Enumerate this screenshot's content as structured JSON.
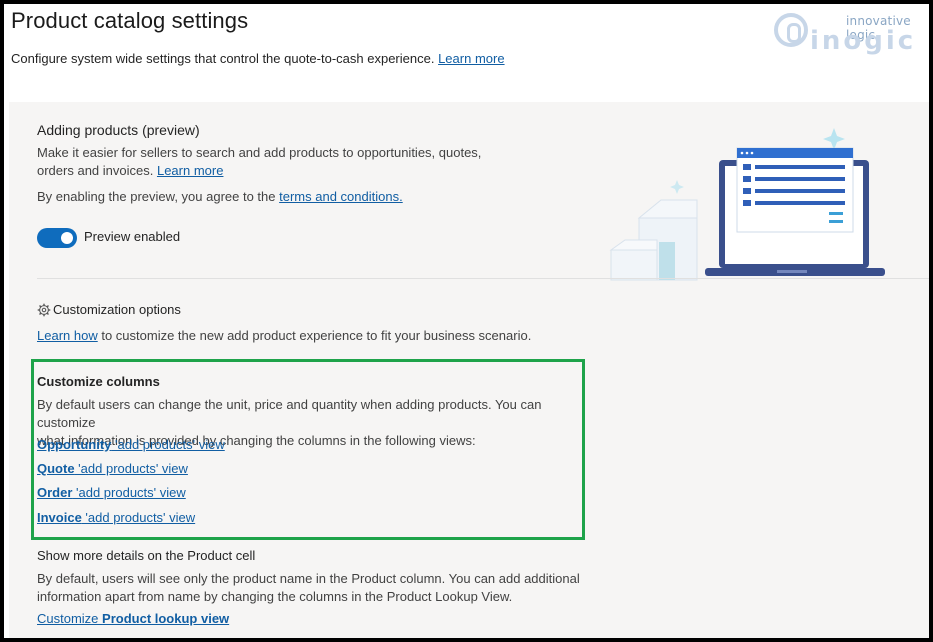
{
  "header": {
    "title": "Product catalog settings",
    "description": "Configure system wide settings that control the quote-to-cash experience.",
    "learn_more": "Learn more"
  },
  "logo": {
    "tagline": "innovative logic",
    "wordmark": "inogic"
  },
  "adding_products": {
    "title": "Adding products (preview)",
    "desc_line1": "Make it easier for sellers to search and add products to opportunities, quotes,",
    "desc_line2": "orders and invoices.",
    "learn_more": "Learn more",
    "terms_prefix": "By enabling the preview, you agree to the",
    "terms_link": "terms and conditions.",
    "toggle_label": "Preview enabled",
    "toggle_on": true
  },
  "customization": {
    "title": "Customization options",
    "learn_how": "Learn how",
    "learn_how_suffix": "to customize the new add product experience to fit your business scenario."
  },
  "customize_columns": {
    "title": "Customize columns",
    "desc_line1": "By default users can change the unit, price and quantity when adding products. You can customize",
    "desc_line2": "what information is provided by changing the columns in the following views:",
    "views": [
      {
        "bold": "Opportunity",
        "rest": " 'add products' view"
      },
      {
        "bold": "Quote",
        "rest": " 'add products' view"
      },
      {
        "bold": "Order",
        "rest": " 'add products' view"
      },
      {
        "bold": "Invoice",
        "rest": " 'add products' view"
      }
    ]
  },
  "product_cell": {
    "title": "Show more details on the Product cell",
    "desc_line1": "By default, users will see only the product name in the Product column. You can add additional",
    "desc_line2": "information apart from name by changing the columns in the Product Lookup View.",
    "link_prefix": "Customize ",
    "link_bold": "Product lookup view"
  },
  "colors": {
    "accent": "#0f6cbd",
    "link": "#115ea3",
    "highlight_box": "#1ea34a"
  },
  "icons": [
    "gear-icon",
    "laptop-illustration",
    "logo-mark"
  ]
}
